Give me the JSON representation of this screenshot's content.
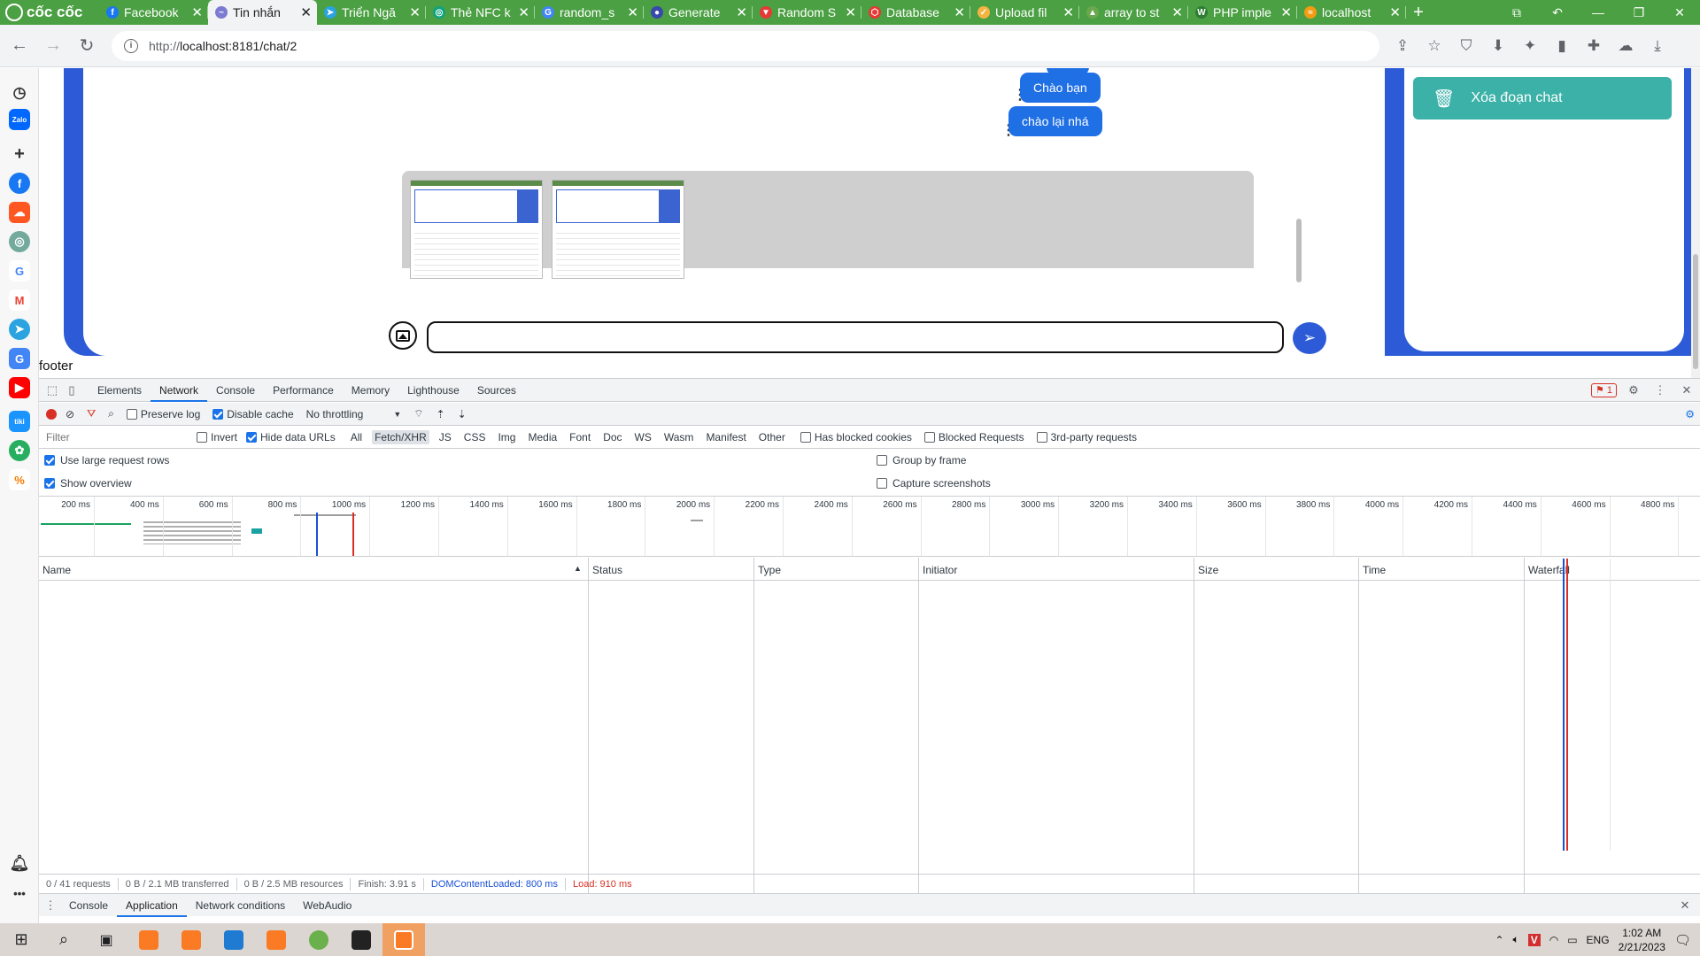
{
  "browser": {
    "brand": "cốc cốc",
    "tabs": [
      {
        "title": "Facebook",
        "color": "#1877f2",
        "glyph": "f"
      },
      {
        "title": "Tin nhắn",
        "color": "#7b7bd1",
        "glyph": "~",
        "active": true
      },
      {
        "title": "Triển Ngă",
        "color": "#2aa3e0",
        "glyph": "➤"
      },
      {
        "title": "Thẻ NFC k",
        "color": "#10a37f",
        "glyph": "◎"
      },
      {
        "title": "random_s",
        "color": "#4285f4",
        "glyph": "G"
      },
      {
        "title": "Generate",
        "color": "#3949ab",
        "glyph": "●"
      },
      {
        "title": "Random S",
        "color": "#e53935",
        "glyph": "▼"
      },
      {
        "title": "Database",
        "color": "#e53935",
        "glyph": "⬡"
      },
      {
        "title": "Upload fil",
        "color": "#f5b342",
        "glyph": "✓"
      },
      {
        "title": "array to st",
        "color": "#6aa84f",
        "glyph": "▲"
      },
      {
        "title": "PHP imple",
        "color": "#2e7d32",
        "glyph": "W"
      },
      {
        "title": "localhost",
        "color": "#f39c12",
        "glyph": "≈"
      }
    ],
    "new_tab": "+",
    "url_prefix": "http://",
    "url": "localhost:8181/chat/2"
  },
  "chat": {
    "messages": [
      {
        "text": "Chào bạn"
      },
      {
        "text": "chào lại nhá"
      }
    ],
    "input_value": "",
    "send_icon": "send-icon",
    "clear_button": "Xóa đoạn chat",
    "footer": "footer"
  },
  "devtools": {
    "tabs": [
      "Elements",
      "Network",
      "Console",
      "Performance",
      "Memory",
      "Lighthouse",
      "Sources"
    ],
    "active_tab": "Network",
    "error_count": "1",
    "toolbar": {
      "preserve_log": "Preserve log",
      "disable_cache": "Disable cache",
      "throttling": "No throttling"
    },
    "filter": {
      "placeholder": "Filter",
      "invert": "Invert",
      "hide_data_urls": "Hide data URLs",
      "types": [
        "All",
        "Fetch/XHR",
        "JS",
        "CSS",
        "Img",
        "Media",
        "Font",
        "Doc",
        "WS",
        "Wasm",
        "Manifest",
        "Other"
      ],
      "selected_type": "Fetch/XHR",
      "blocked_cookies": "Has blocked cookies",
      "blocked_requests": "Blocked Requests",
      "third_party": "3rd-party requests"
    },
    "options": {
      "large_rows": "Use large request rows",
      "show_overview": "Show overview",
      "group_by_frame": "Group by frame",
      "capture_screenshots": "Capture screenshots"
    },
    "timeline_labels": [
      "200 ms",
      "400 ms",
      "600 ms",
      "800 ms",
      "1000 ms",
      "1200 ms",
      "1400 ms",
      "1600 ms",
      "1800 ms",
      "2000 ms",
      "2200 ms",
      "2400 ms",
      "2600 ms",
      "2800 ms",
      "3000 ms",
      "3200 ms",
      "3400 ms",
      "3600 ms",
      "3800 ms",
      "4000 ms",
      "4200 ms",
      "4400 ms",
      "4600 ms",
      "4800 ms"
    ],
    "columns": [
      "Name",
      "Status",
      "Type",
      "Initiator",
      "Size",
      "Time",
      "Waterfall"
    ],
    "status": {
      "requests": "0 / 41 requests",
      "transferred": "0 B / 2.1 MB transferred",
      "resources": "0 B / 2.5 MB resources",
      "finish": "Finish: 3.91 s",
      "dom_content_loaded": "DOMContentLoaded: 800 ms",
      "load": "Load: 910 ms"
    },
    "drawer_tabs": [
      "Console",
      "Application",
      "Network conditions",
      "WebAudio"
    ],
    "drawer_active": "Application"
  },
  "taskbar": {
    "language": "ENG",
    "time": "1:02 AM",
    "date": "2/21/2023"
  },
  "colors": {
    "browser_green": "#4ba043",
    "chat_blue": "#2d5bd8",
    "bubble_blue": "#1f6fe5",
    "clear_teal": "#3bb1a8",
    "dcl_blue": "#1a4fd6",
    "load_red": "#d93025"
  }
}
